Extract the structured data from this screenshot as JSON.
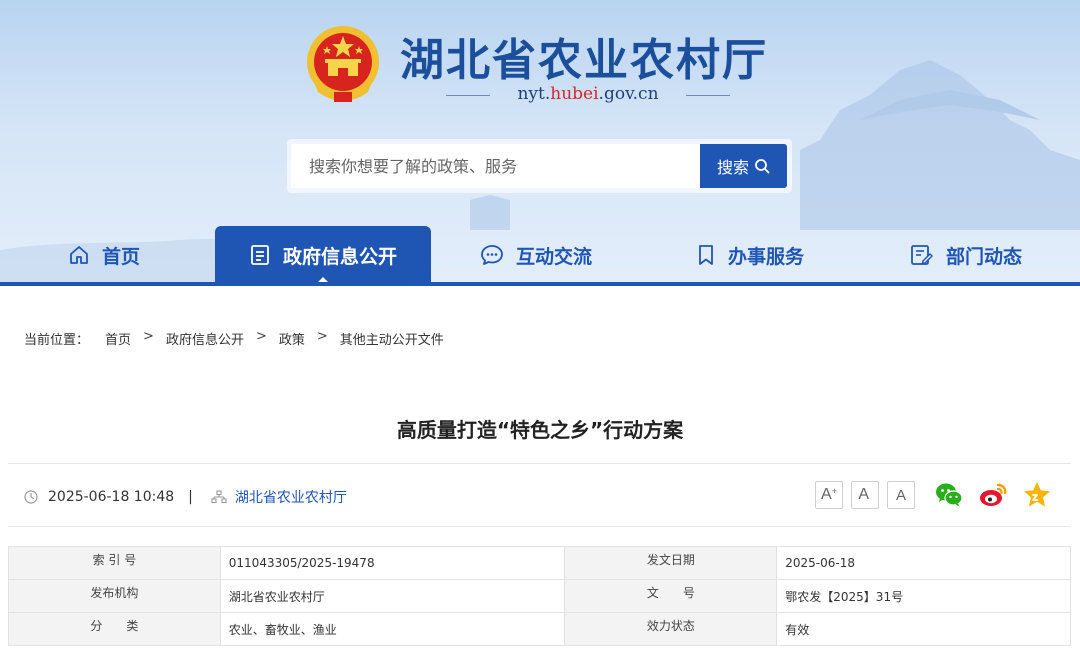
{
  "header": {
    "site_title": "湖北省农业农村厅",
    "domain_prefix": "nyt.",
    "domain_highlight": "hubei",
    "domain_suffix": ".gov.cn",
    "emblem_icon": "national-emblem"
  },
  "search": {
    "placeholder": "搜索你想要了解的政策、服务",
    "button_label": "搜索"
  },
  "nav": {
    "items": [
      {
        "label": "首页",
        "icon": "home-icon",
        "active": false
      },
      {
        "label": "政府信息公开",
        "icon": "document-icon",
        "active": true
      },
      {
        "label": "互动交流",
        "icon": "chat-icon",
        "active": false
      },
      {
        "label": "办事服务",
        "icon": "bookmark-icon",
        "active": false
      },
      {
        "label": "部门动态",
        "icon": "news-icon",
        "active": false
      }
    ]
  },
  "breadcrumb": {
    "label": "当前位置：",
    "items": [
      "首页",
      "政府信息公开",
      "政策",
      "其他主动公开文件"
    ],
    "separator": ">"
  },
  "article": {
    "title": "高质量打造“特色之乡”行动方案",
    "datetime": "2025-06-18 10:48",
    "meta_separator": "|",
    "publisher": "湖北省农业农村厅"
  },
  "font_size_buttons": [
    "A+",
    "A",
    "A"
  ],
  "share_icons": [
    "wechat-icon",
    "weibo-icon",
    "favorite-icon"
  ],
  "info_table": {
    "rows": [
      {
        "k1": "索 引 号",
        "v1": "011043305/2025-19478",
        "k2": "发文日期",
        "v2": "2025-06-18"
      },
      {
        "k1": "发布机构",
        "v1": "湖北省农业农村厅",
        "k2": "文　　号",
        "v2": "鄂农发【2025】31号"
      },
      {
        "k1": "分　　类",
        "v1": "农业、畜牧业、渔业",
        "k2": "效力状态",
        "v2": "有效"
      }
    ]
  },
  "colors": {
    "brand_blue": "#1f56b4",
    "title_blue": "#1b4f9b",
    "domain_red": "#d4262a"
  }
}
